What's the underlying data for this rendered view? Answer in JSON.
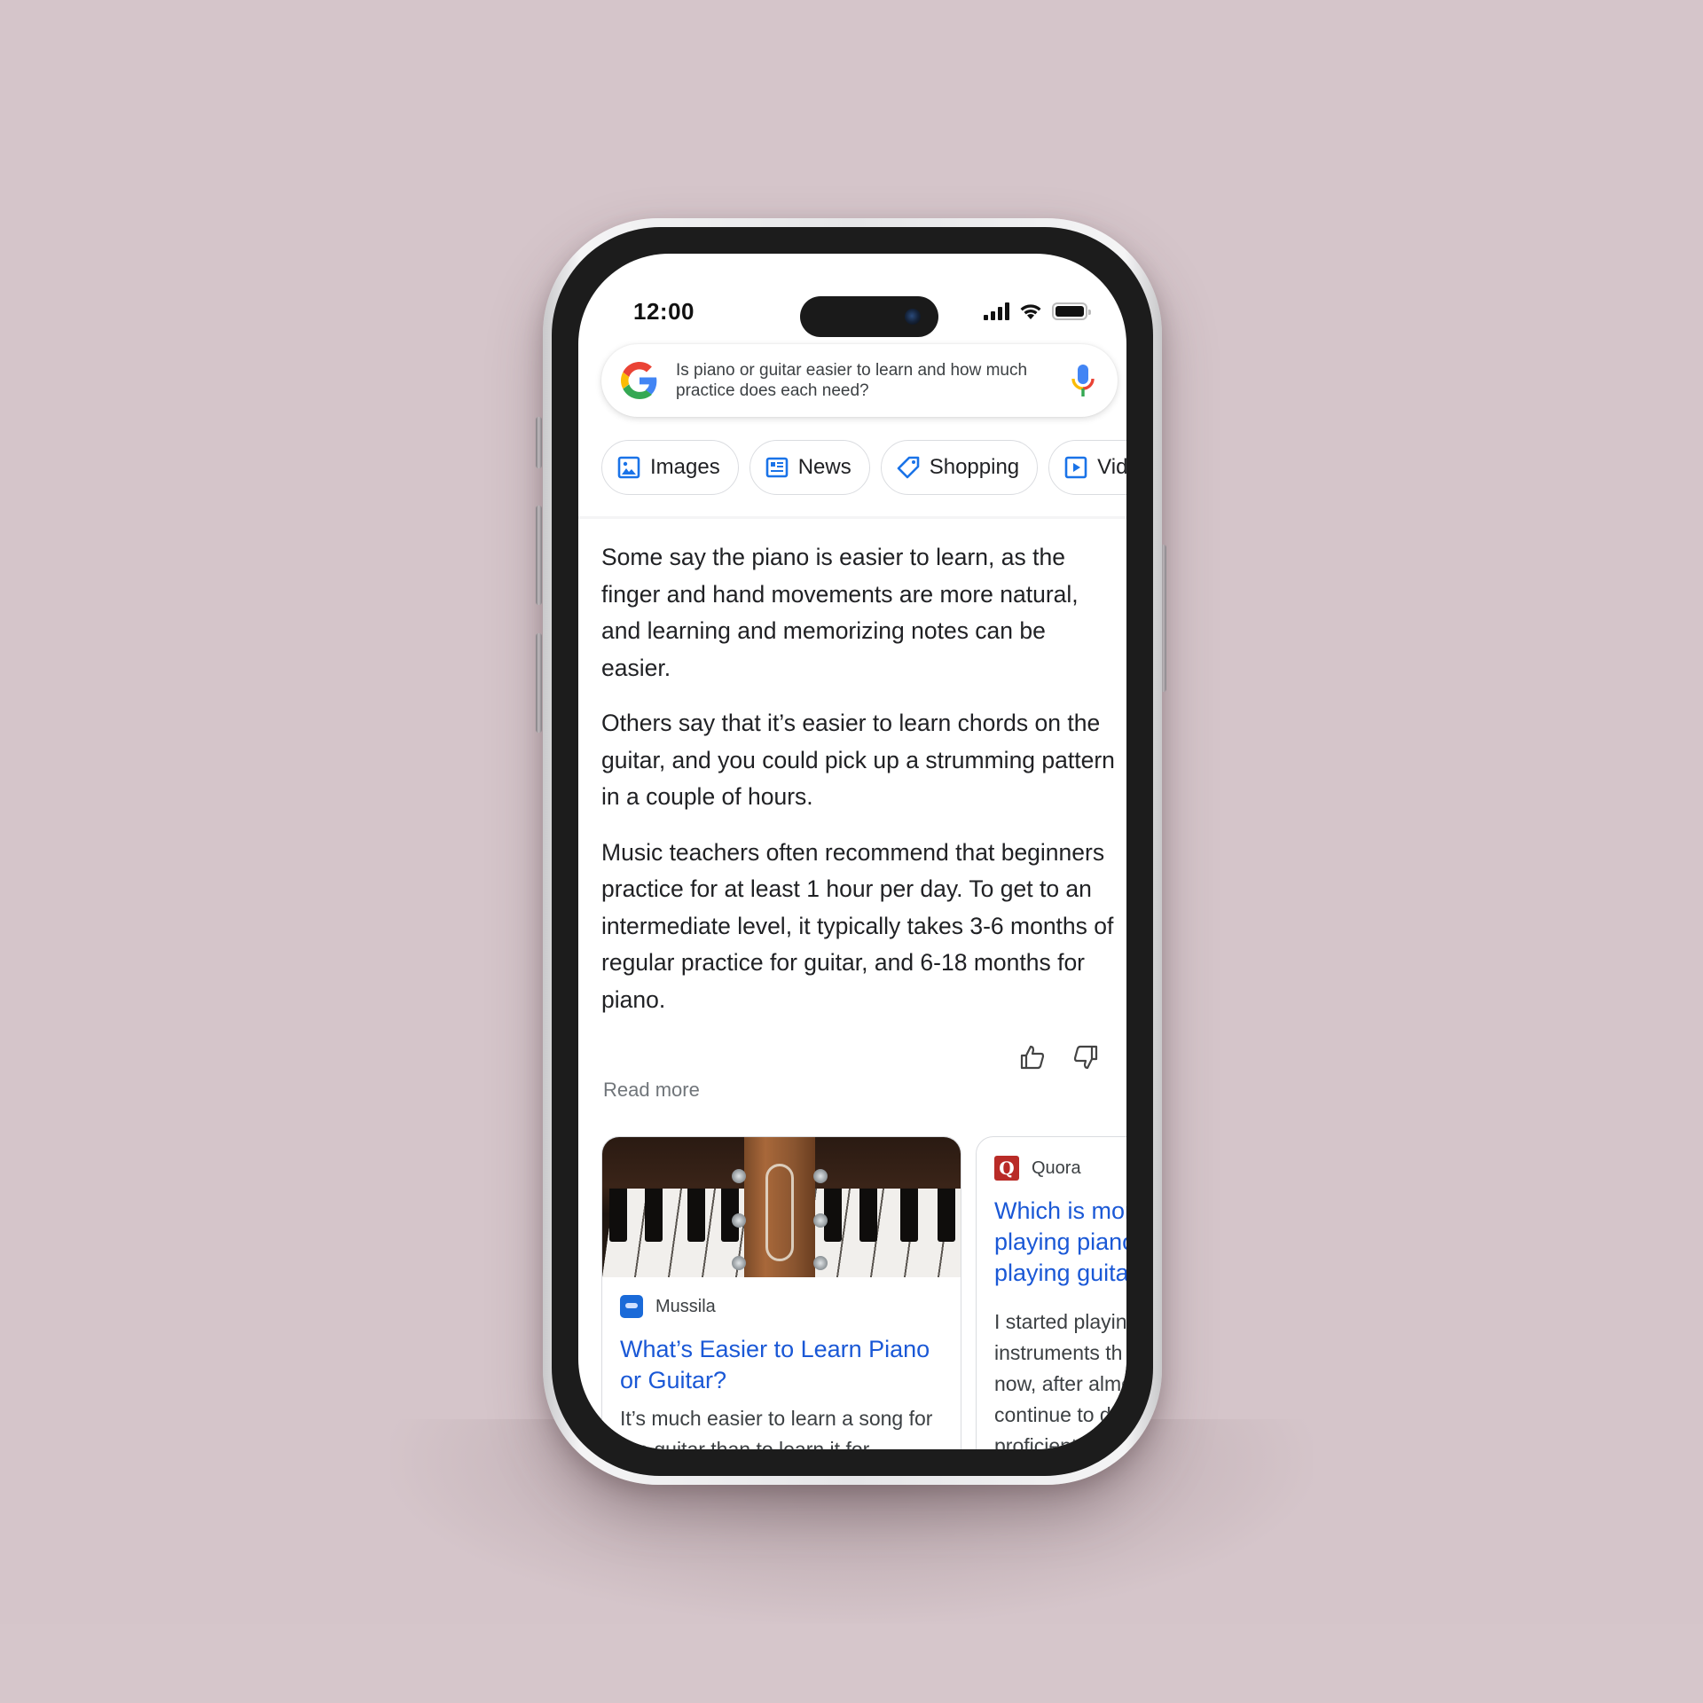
{
  "status_bar": {
    "time": "12:00",
    "icons": [
      "cellular-signal-icon",
      "wifi-icon",
      "battery-icon"
    ]
  },
  "search": {
    "logo": "google-g-logo",
    "query": "Is piano or guitar easier to learn and how much practice does each need?",
    "mic_icon": "microphone-icon"
  },
  "chips": [
    {
      "label": "Images",
      "icon": "image-icon"
    },
    {
      "label": "News",
      "icon": "news-icon"
    },
    {
      "label": "Shopping",
      "icon": "tag-icon"
    },
    {
      "label": "Videos",
      "icon": "play-video-icon"
    }
  ],
  "answer": {
    "paragraphs": [
      "Some say the piano is easier to learn, as the finger and hand movements are more natural, and learning and memorizing notes can be easier.",
      "Others say that it’s easier to learn chords on the guitar, and you could pick up a strumming pattern in a couple of hours.",
      "Music teachers often recommend that beginners practice for at least 1 hour per day. To get to an intermediate level, it typically takes 3-6 months of regular practice for guitar, and 6-18 months for piano."
    ],
    "feedback": {
      "thumbs_up": "thumbs-up-icon",
      "thumbs_down": "thumbs-down-icon"
    },
    "read_more": "Read more"
  },
  "cards": [
    {
      "source": "Mussila",
      "title": "What’s Easier to Learn Piano or Guitar?",
      "snippet": "It’s much easier to learn a song for the guitar than to learn it for",
      "image_alt": "guitar headstock resting on piano keys"
    },
    {
      "source": "Quora",
      "favicon_letter": "Q",
      "title_lines": [
        "Which is more",
        "playing piano",
        "playing guitar"
      ],
      "snippet_lines": [
        "I started playing",
        "instruments th",
        "now, after almo",
        "continue to de",
        "proficient"
      ]
    }
  ],
  "colors": {
    "link_blue": "#1a58d6",
    "google_blue": "#4285f4",
    "google_red": "#ea4335",
    "google_yellow": "#fbbc05",
    "google_green": "#34a853",
    "background": "#d5c5ca"
  }
}
